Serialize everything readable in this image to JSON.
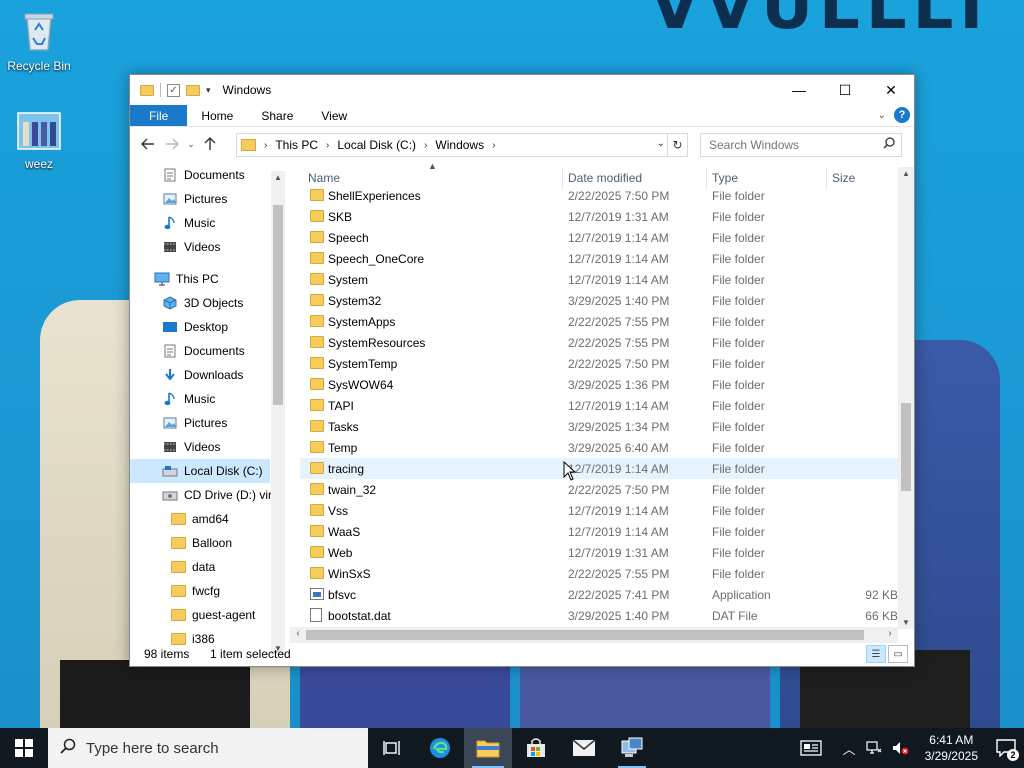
{
  "desktop": {
    "icons": [
      {
        "label": "Recycle Bin",
        "icon": "recycle-bin-icon"
      },
      {
        "label": "weez",
        "icon": "image-file-icon"
      }
    ],
    "wallpaper_text": "VVULLLI"
  },
  "window": {
    "title": "Windows",
    "controls": {
      "minimize": "—",
      "maximize": "☐",
      "close": "✕"
    }
  },
  "ribbon": {
    "tabs": [
      "File",
      "Home",
      "Share",
      "View"
    ],
    "help": "?"
  },
  "address_bar": {
    "crumbs": [
      "This PC",
      "Local Disk (C:)",
      "Windows"
    ],
    "search_placeholder": "Search Windows"
  },
  "nav_pane": {
    "items": [
      {
        "label": "Documents",
        "icon": "documents-icon",
        "pinned": true
      },
      {
        "label": "Pictures",
        "icon": "pictures-icon",
        "pinned": true
      },
      {
        "label": "Music",
        "icon": "music-icon"
      },
      {
        "label": "Videos",
        "icon": "videos-icon"
      },
      {
        "label": "This PC",
        "icon": "this-pc-icon"
      },
      {
        "label": "3D Objects",
        "icon": "3d-objects-icon"
      },
      {
        "label": "Desktop",
        "icon": "desktop-icon"
      },
      {
        "label": "Documents",
        "icon": "documents-icon"
      },
      {
        "label": "Downloads",
        "icon": "downloads-icon"
      },
      {
        "label": "Music",
        "icon": "music-icon"
      },
      {
        "label": "Pictures",
        "icon": "pictures-icon"
      },
      {
        "label": "Videos",
        "icon": "videos-icon"
      },
      {
        "label": "Local Disk (C:)",
        "icon": "local-disk-icon",
        "selected": true
      },
      {
        "label": "CD Drive (D:) virt",
        "icon": "cd-drive-icon"
      },
      {
        "label": "amd64",
        "icon": "folder-icon"
      },
      {
        "label": "Balloon",
        "icon": "folder-icon"
      },
      {
        "label": "data",
        "icon": "folder-icon"
      },
      {
        "label": "fwcfg",
        "icon": "folder-icon"
      },
      {
        "label": "guest-agent",
        "icon": "folder-icon"
      },
      {
        "label": "i386",
        "icon": "folder-icon"
      }
    ]
  },
  "file_list": {
    "columns": {
      "name": "Name",
      "date": "Date modified",
      "type": "Type",
      "size": "Size"
    },
    "rows": [
      {
        "name": "ShellExperiences",
        "date": "2/22/2025 7:50 PM",
        "type": "File folder",
        "size": "",
        "icon": "folder-icon"
      },
      {
        "name": "SKB",
        "date": "12/7/2019 1:31 AM",
        "type": "File folder",
        "size": "",
        "icon": "folder-icon"
      },
      {
        "name": "Speech",
        "date": "12/7/2019 1:14 AM",
        "type": "File folder",
        "size": "",
        "icon": "folder-icon"
      },
      {
        "name": "Speech_OneCore",
        "date": "12/7/2019 1:14 AM",
        "type": "File folder",
        "size": "",
        "icon": "folder-icon"
      },
      {
        "name": "System",
        "date": "12/7/2019 1:14 AM",
        "type": "File folder",
        "size": "",
        "icon": "folder-icon"
      },
      {
        "name": "System32",
        "date": "3/29/2025 1:40 PM",
        "type": "File folder",
        "size": "",
        "icon": "folder-icon"
      },
      {
        "name": "SystemApps",
        "date": "2/22/2025 7:55 PM",
        "type": "File folder",
        "size": "",
        "icon": "folder-icon"
      },
      {
        "name": "SystemResources",
        "date": "2/22/2025 7:55 PM",
        "type": "File folder",
        "size": "",
        "icon": "folder-icon"
      },
      {
        "name": "SystemTemp",
        "date": "2/22/2025 7:50 PM",
        "type": "File folder",
        "size": "",
        "icon": "folder-icon"
      },
      {
        "name": "SysWOW64",
        "date": "3/29/2025 1:36 PM",
        "type": "File folder",
        "size": "",
        "icon": "folder-icon"
      },
      {
        "name": "TAPI",
        "date": "12/7/2019 1:14 AM",
        "type": "File folder",
        "size": "",
        "icon": "folder-icon"
      },
      {
        "name": "Tasks",
        "date": "3/29/2025 1:34 PM",
        "type": "File folder",
        "size": "",
        "icon": "folder-icon"
      },
      {
        "name": "Temp",
        "date": "3/29/2025 6:40 AM",
        "type": "File folder",
        "size": "",
        "icon": "folder-icon"
      },
      {
        "name": "tracing",
        "date": "12/7/2019 1:14 AM",
        "type": "File folder",
        "size": "",
        "icon": "folder-icon",
        "hover": true
      },
      {
        "name": "twain_32",
        "date": "2/22/2025 7:50 PM",
        "type": "File folder",
        "size": "",
        "icon": "folder-icon"
      },
      {
        "name": "Vss",
        "date": "12/7/2019 1:14 AM",
        "type": "File folder",
        "size": "",
        "icon": "folder-icon"
      },
      {
        "name": "WaaS",
        "date": "12/7/2019 1:14 AM",
        "type": "File folder",
        "size": "",
        "icon": "folder-icon"
      },
      {
        "name": "Web",
        "date": "12/7/2019 1:31 AM",
        "type": "File folder",
        "size": "",
        "icon": "folder-icon"
      },
      {
        "name": "WinSxS",
        "date": "2/22/2025 7:55 PM",
        "type": "File folder",
        "size": "",
        "icon": "folder-icon"
      },
      {
        "name": "bfsvc",
        "date": "2/22/2025 7:41 PM",
        "type": "Application",
        "size": "92 KB",
        "icon": "application-icon"
      },
      {
        "name": "bootstat.dat",
        "date": "3/29/2025 1:40 PM",
        "type": "DAT File",
        "size": "66 KB",
        "icon": "document-icon"
      }
    ]
  },
  "status_bar": {
    "item_count": "98 items",
    "selection": "1 item selected"
  },
  "taskbar": {
    "search_placeholder": "Type here to search",
    "apps": [
      "task-view-icon",
      "edge-icon",
      "file-explorer-icon",
      "store-icon",
      "mail-icon",
      "network-app-icon"
    ],
    "clock_time": "6:41 AM",
    "clock_date": "3/29/2025",
    "notification_count": "2"
  },
  "colors": {
    "accent": "#1979ca",
    "selection": "#cce8ff",
    "hover": "#e5f3ff",
    "desktop": "#1b98d3",
    "taskbar": "#101820"
  }
}
